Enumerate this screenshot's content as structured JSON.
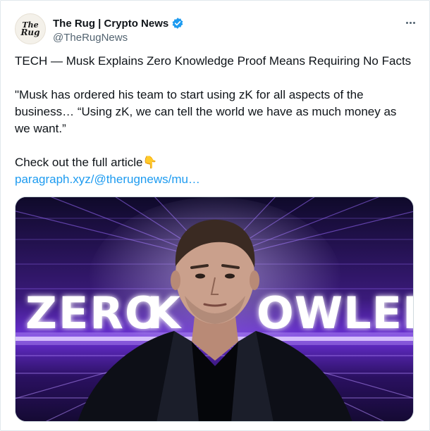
{
  "post": {
    "author": {
      "display_name": "The Rug | Crypto News",
      "handle": "@TheRugNews",
      "avatar_line1": "The",
      "avatar_line2": "Rug",
      "verified": true,
      "verified_color": "#1d9bf0"
    },
    "text": {
      "line1": "TECH — Musk Explains Zero Knowledge Proof Means Requiring No Facts",
      "quote_line1": "\"Musk has ordered his team to start using zK for all aspects of the",
      "quote_line2": "business… “Using zK, we can tell the world we have as much money as",
      "quote_line3": "we want.”",
      "cta": "Check out the full article",
      "cta_emoji": "👇",
      "link": "paragraph.xyz/@therugnews/mu…"
    },
    "media": {
      "headline_left": "ZERO",
      "headline_mid": "K",
      "headline_right": "OWLEDGE",
      "accent_color": "#8a3dff",
      "glow_color": "#d9c2ff"
    }
  },
  "icons": {
    "verified": "verified-badge-icon",
    "more": "more-options-icon"
  }
}
